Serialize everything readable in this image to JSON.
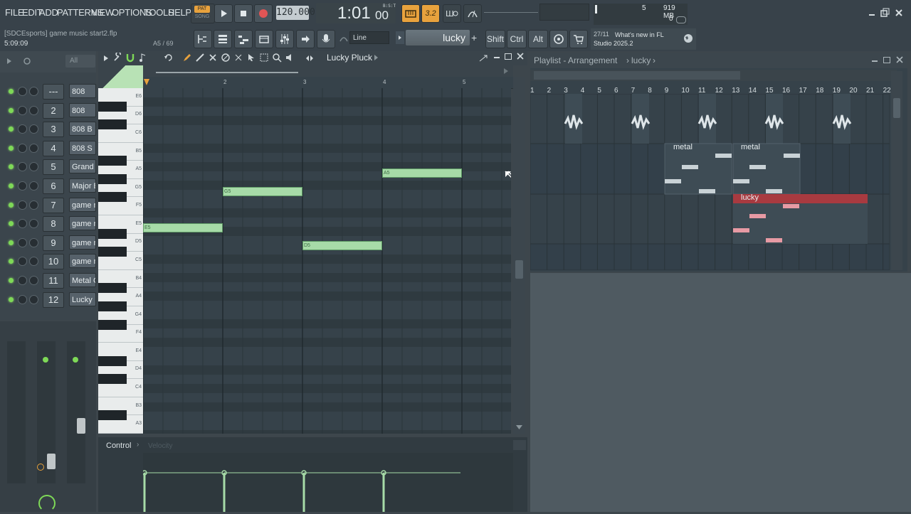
{
  "menu": [
    "FILE",
    "EDIT",
    "ADD",
    "PATTERNS",
    "VIEW",
    "OPTIONS",
    "TOOLS",
    "HELP"
  ],
  "transport": {
    "pat_label": "PAT",
    "song_label": "SONG",
    "tempo": "120.000",
    "time": "1:01",
    "time_sub": "00",
    "bst": "B:S:T",
    "snap": "3.2"
  },
  "stats": {
    "cpu": "5",
    "memory": "919 MB",
    "polyphony": "0"
  },
  "project": {
    "filename": "[SDCEsports] game music start2.flp",
    "elapsed": "5:09:09",
    "hint": "A5 / 69"
  },
  "toolbar": {
    "snap_mode": "Line",
    "pattern": "lucky",
    "shift": "Shift",
    "ctrl": "Ctrl",
    "alt": "Alt"
  },
  "news": {
    "date": "27/11",
    "text": "What's new in FL Studio 2025.2"
  },
  "channel_rack": {
    "filter": "All",
    "channels": [
      {
        "num": "---",
        "name": "808"
      },
      {
        "num": "2",
        "name": "808"
      },
      {
        "num": "3",
        "name": "808 B"
      },
      {
        "num": "4",
        "name": "808 S"
      },
      {
        "num": "5",
        "name": "Grand"
      },
      {
        "num": "6",
        "name": "Major B"
      },
      {
        "num": "7",
        "name": "game m"
      },
      {
        "num": "8",
        "name": "game m"
      },
      {
        "num": "9",
        "name": "game m"
      },
      {
        "num": "10",
        "name": "game m"
      },
      {
        "num": "11",
        "name": "Metal C"
      },
      {
        "num": "12",
        "name": "Lucky"
      }
    ]
  },
  "piano_roll": {
    "instrument": "Lucky Pluck",
    "bars": [
      "2",
      "3",
      "4",
      "5"
    ],
    "keys": [
      "E6",
      "D6",
      "C6",
      "B5",
      "A5",
      "G5",
      "F5",
      "E5",
      "D5",
      "C5",
      "B4",
      "A4",
      "G4",
      "F4",
      "E4",
      "D4",
      "C4",
      "B3",
      "A3"
    ],
    "notes": [
      {
        "label": "E5",
        "bar_start": 1,
        "bar_end": 2
      },
      {
        "label": "G5",
        "bar_start": 2,
        "bar_end": 3
      },
      {
        "label": "D5",
        "bar_start": 3,
        "bar_end": 4
      },
      {
        "label": "A5",
        "bar_start": 4,
        "bar_end": 5
      }
    ],
    "control_label": "Control",
    "control_target": "Velocity"
  },
  "playlist": {
    "title": "Playlist - Arrangement",
    "pattern": "lucky",
    "ruler": [
      "1",
      "2",
      "3",
      "4",
      "5",
      "6",
      "7",
      "8",
      "9",
      "10",
      "11",
      "12",
      "13",
      "14",
      "15",
      "16",
      "17",
      "18",
      "19",
      "20",
      "21",
      "22"
    ],
    "clips": [
      {
        "name": "metal"
      },
      {
        "name": "metal"
      },
      {
        "name": "lucky"
      }
    ]
  },
  "colors": {
    "note": "#a7dba8",
    "accent_red": "#a83a40",
    "clip_pink": "#e79aa4",
    "led": "#7ed957"
  }
}
